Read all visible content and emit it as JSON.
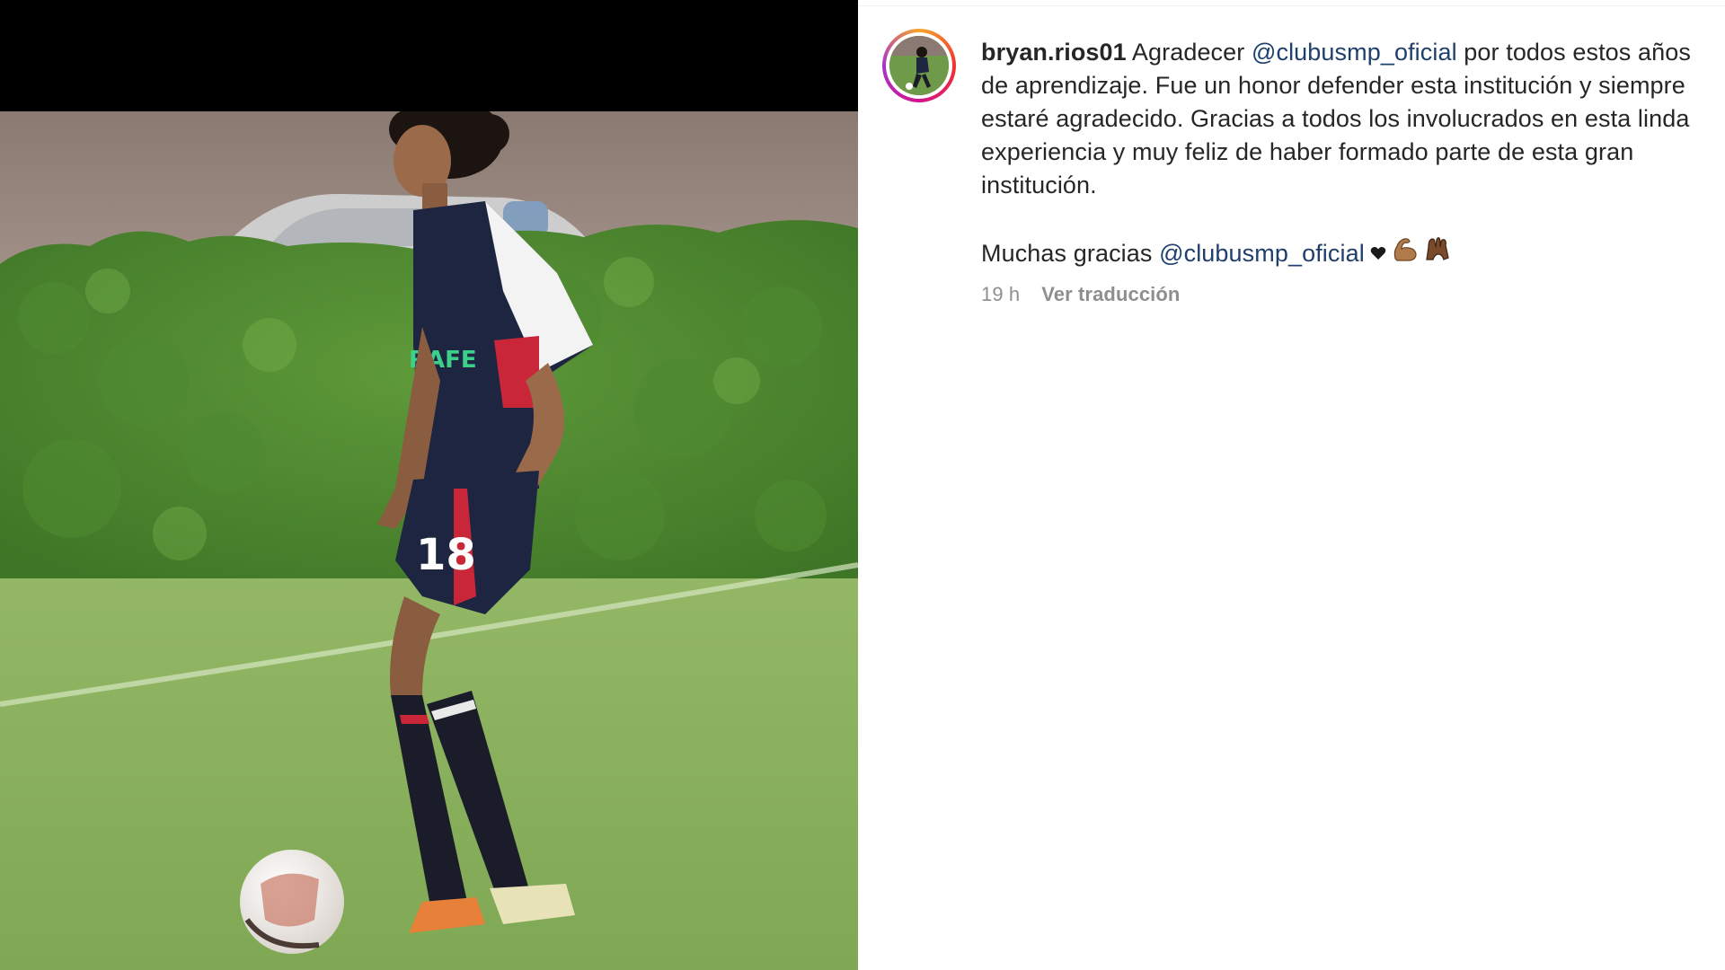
{
  "post": {
    "username": "bryan.rios01",
    "caption_intro": " Agradecer ",
    "mention_1": "@clubusmp_oficial",
    "caption_main": " por todos estos años de aprendizaje. Fue un honor defender esta institución y siempre estaré agradecido. Gracias a todos los involucrados en esta linda experiencia y muy feliz de haber formado parte de esta gran institución.",
    "caption_thanks": "Muchas gracias ",
    "mention_2": "@clubusmp_oficial",
    "emojis": [
      "heart-icon",
      "flexed-biceps-icon",
      "raised-hands-icon"
    ],
    "time_ago": "19 h",
    "translate_label": "Ver traducción"
  },
  "photo": {
    "jersey_number": "18",
    "sponsor_text": "RAFE"
  },
  "colors": {
    "mention": "#1f3f6d",
    "text": "#262626",
    "meta": "#8e8e8e",
    "story_ring": [
      "#f9a52a",
      "#f0312f",
      "#d4138c",
      "#a535c9"
    ]
  }
}
